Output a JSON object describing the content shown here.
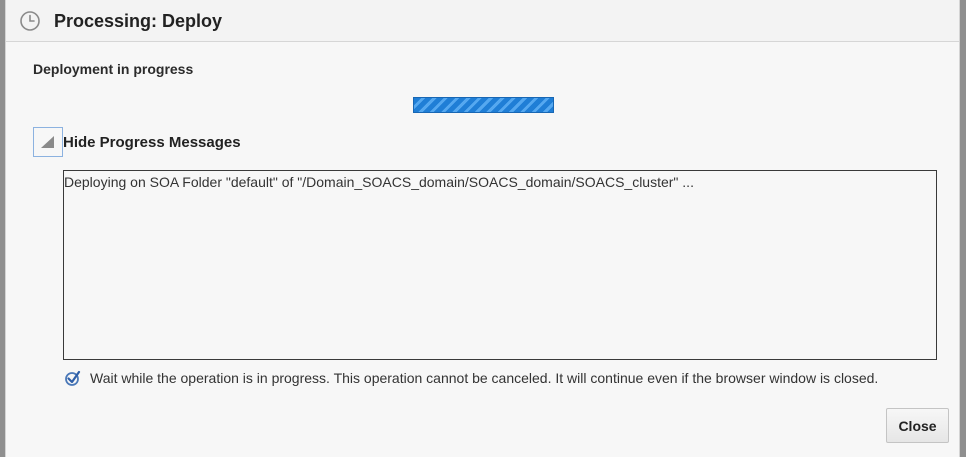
{
  "dialog": {
    "title": "Processing: Deploy",
    "title_icon": "clock-icon",
    "status_text": "Deployment in progress",
    "progress": {
      "state": "indeterminate",
      "color": "#1f7ed6"
    },
    "toggle": {
      "label": "Hide Progress Messages",
      "icon": "collapse-triangle-icon"
    },
    "messages": [
      "Deploying on SOA Folder \"default\" of \"/Domain_SOACS_domain/SOACS_domain/SOACS_cluster\" ..."
    ],
    "info": {
      "icon": "check-icon",
      "text": "Wait while the operation is in progress. This operation cannot be canceled. It will continue even if the browser window is closed."
    },
    "close_label": "Close"
  },
  "colors": {
    "accent": "#1f7ed6",
    "dialog_bg": "#f7f7f7",
    "backdrop": "#8f8f8f"
  }
}
